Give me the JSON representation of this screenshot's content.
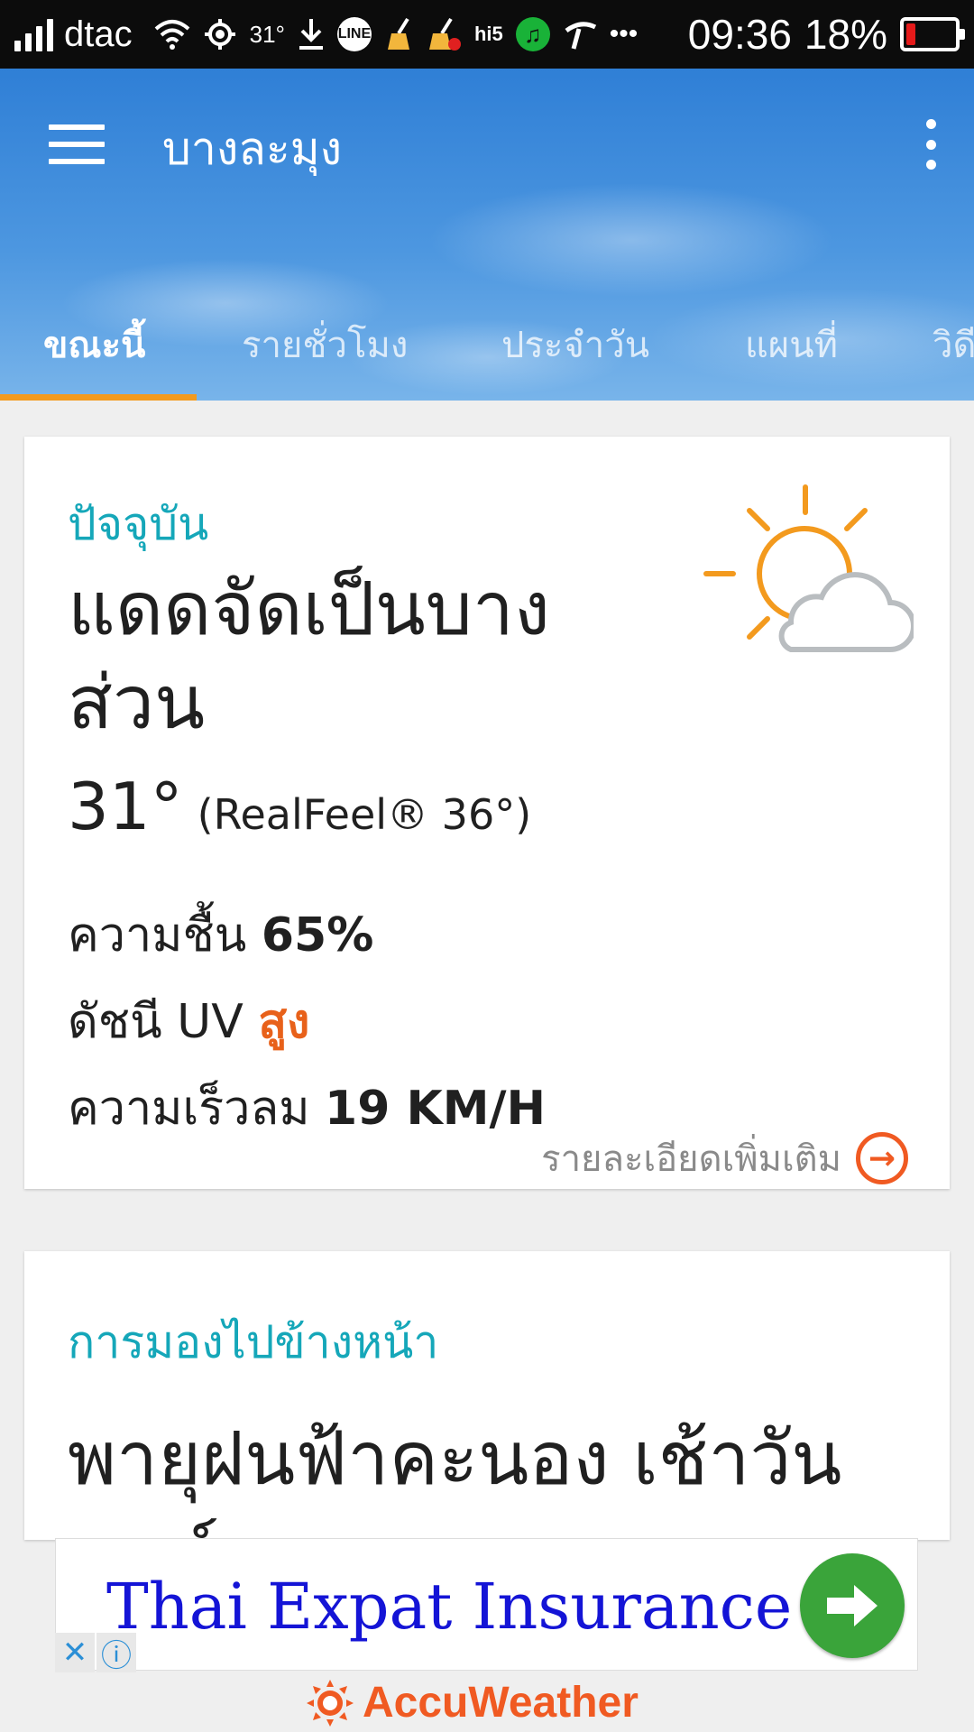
{
  "status_bar": {
    "carrier": "dtac",
    "temp_indicator": "31°",
    "line_label": "LINE",
    "hi5_label": "hi5",
    "more_label": "•••",
    "time": "09:36",
    "battery_percent": "18%",
    "battery_level": 0.18
  },
  "header": {
    "location": "บางละมุง",
    "tabs": [
      {
        "label": "ขณะนี้",
        "active": true
      },
      {
        "label": "รายชั่วโมง",
        "active": false
      },
      {
        "label": "ประจำวัน",
        "active": false
      },
      {
        "label": "แผนที่",
        "active": false
      },
      {
        "label": "วิดี",
        "active": false
      }
    ]
  },
  "current": {
    "section_label": "ปัจจุบัน",
    "condition": "แดดจัดเป็นบางส่วน",
    "temperature": "31°",
    "realfeel": "(RealFeel® 36°)",
    "humidity_label": "ความชื้น",
    "humidity_value": "65%",
    "uv_label": "ดัชนี UV",
    "uv_value": "สูง",
    "wind_label": "ความเร็วลม",
    "wind_value": "19 KM/H",
    "more_details": "รายละเอียดเพิ่มเติม",
    "icon": "partly-sunny-icon",
    "colors": {
      "accent": "#15a7b9",
      "uv_high": "#e8611a",
      "sun": "#f39a1e",
      "cloud": "#b9bdc0"
    }
  },
  "outlook": {
    "section_label": "การมองไปข้างหน้า",
    "text": "พายุฝนฟ้าคะนอง เช้าวันเสาร์"
  },
  "ad": {
    "text": "Thai Expat Insurance »",
    "close_glyph": "✕",
    "info_glyph": "ⓘ"
  },
  "brand": {
    "name": "AccuWeather",
    "color": "#f05a22"
  }
}
